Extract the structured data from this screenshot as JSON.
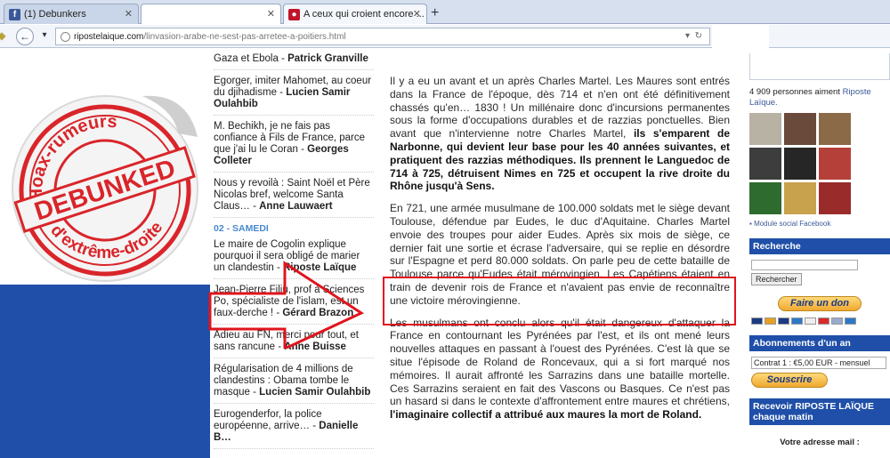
{
  "browser": {
    "tabs": [
      {
        "label": "(1) Debunkers",
        "favicon": "facebook-icon",
        "active": false
      },
      {
        "label": "",
        "favicon": "",
        "active": false
      },
      {
        "label": "A ceux qui croient encore ...",
        "favicon": "ripostelaique-icon",
        "active": true
      }
    ],
    "url_host": "ripostelaique.com",
    "url_path": "/linvasion-arabe-ne-sest-pas-arretee-a-poitiers.html"
  },
  "stamp": {
    "top_text": "Hoax-rumeurs",
    "middle_text": "DEBUNKED",
    "bottom_text": "d'extrême-droite"
  },
  "left_column": {
    "items": [
      {
        "title": "Gaza et Ebola - ",
        "author": "Patrick Granville"
      },
      {
        "title": "Egorger, imiter Mahomet, au coeur du djihadisme - ",
        "author": "Lucien Samir Oulahbib"
      },
      {
        "title": "M. Bechikh, je ne fais pas confiance à Fils de France, parce que j'ai lu le Coran - ",
        "author": "Georges Colleter"
      },
      {
        "title": "Nous y revoilà : Saint Noël et Père Nicolas bref, welcome Santa Claus… - ",
        "author": "Anne Lauwaert"
      }
    ],
    "date": "02 - SAMEDI",
    "items2": [
      {
        "title": "Le maire de Cogolin explique pourquoi il sera obligé de marier un clandestin - ",
        "author": "Riposte Laïque"
      },
      {
        "title": "Jean-Pierre Filiu, prof à Sciences Po, spécialiste de l'islam, est un faux-derche ! - ",
        "author": "Gérard Brazon"
      },
      {
        "title": "Adieu au FN, merci pour tout, et sans rancune - ",
        "author": "Anne Buisse"
      },
      {
        "title": "Régularisation de 4 millions de clandestins : Obama tombe le masque - ",
        "author": "Lucien Samir Oulahbib"
      },
      {
        "title": "Eurogenderfor, la police européenne, arrive… - ",
        "author": "Danielle B…"
      }
    ]
  },
  "article": {
    "p1_text": "Il y a eu un avant et un après Charles Martel. Les Maures sont entrés dans la France de l'époque, dès 714 et n'en ont été définitivement chassés qu'en… 1830 ! Un millénaire donc d'incursions permanentes sous la forme d'occupations durables et de razzias ponctuelles.  Bien avant que n'intervienne notre Charles Martel, ",
    "p1_bold": "ils s'emparent de Narbonne, qui devient leur base pour les 40 années suivantes, et pratiquent des razzias méthodiques. Ils prennent le Languedoc de 714 à 725, détruisent Nimes en 725 et occupent la rive droite du Rhône jusqu'à Sens.",
    "p2_text": "En 721, une armée musulmane de 100.000 soldats met le siège devant Toulouse, défendue par Eudes, le duc d'Aquitaine. Charles Martel envoie des troupes pour aider Eudes. Après six mois de siège, ce dernier fait une sortie et écrase l'adversaire, qui se replie en désordre sur l'Espagne et perd 80.000 soldats. On parle peu de cette bataille de Toulouse parce qu'Eudes était mérovingien.",
    "p2_highlight": " Les Capétiens étaient en train de devenir rois de France et n'avaient pas envie de reconnaître une victoire mérovingienne.",
    "p3_text": "Les musulmans ont conclu alors qu'il était dangereux d'attaquer la France en contournant les Pyrénées par l'est, et ils ont mené leurs nouvelles attaques en passant à l'ouest des Pyrénées. C'est là que se situe l'épisode de Roland de Roncevaux, qui a si fort marqué nos mémoires. Il aurait affronté les Sarrazins dans une bataille mortelle. Ces Sarrazins seraient en fait des Vascons ou Basques. Ce n'est pas un hasard si dans le contexte d'affrontement entre maures et chrétiens, ",
    "p3_bold": "l'imaginaire collectif a attribué aux maures la mort de Roland."
  },
  "sidebar": {
    "fb_likes_count": "4 909",
    "fb_likes_text": " personnes aiment ",
    "fb_likes_link": "Riposte Laïque.",
    "fb_social": "Module social Facebook",
    "recherche_title": "Recherche",
    "rechercher_button": "Rechercher",
    "don_button": "Faire un don",
    "abonnements_title": "Abonnements d'un an",
    "plan_option": "Contrat 1 : €5,00 EUR - mensuel",
    "souscrire_button": "Souscrire",
    "recevoir_title": "Recevoir RIPOSTE LAÏQUE chaque matin",
    "email_label": "Votre adresse mail :"
  },
  "colors": {
    "accent_blue": "#1f4fa8",
    "annotation_red": "#e0141c",
    "stamp_red": "#d9252a"
  }
}
